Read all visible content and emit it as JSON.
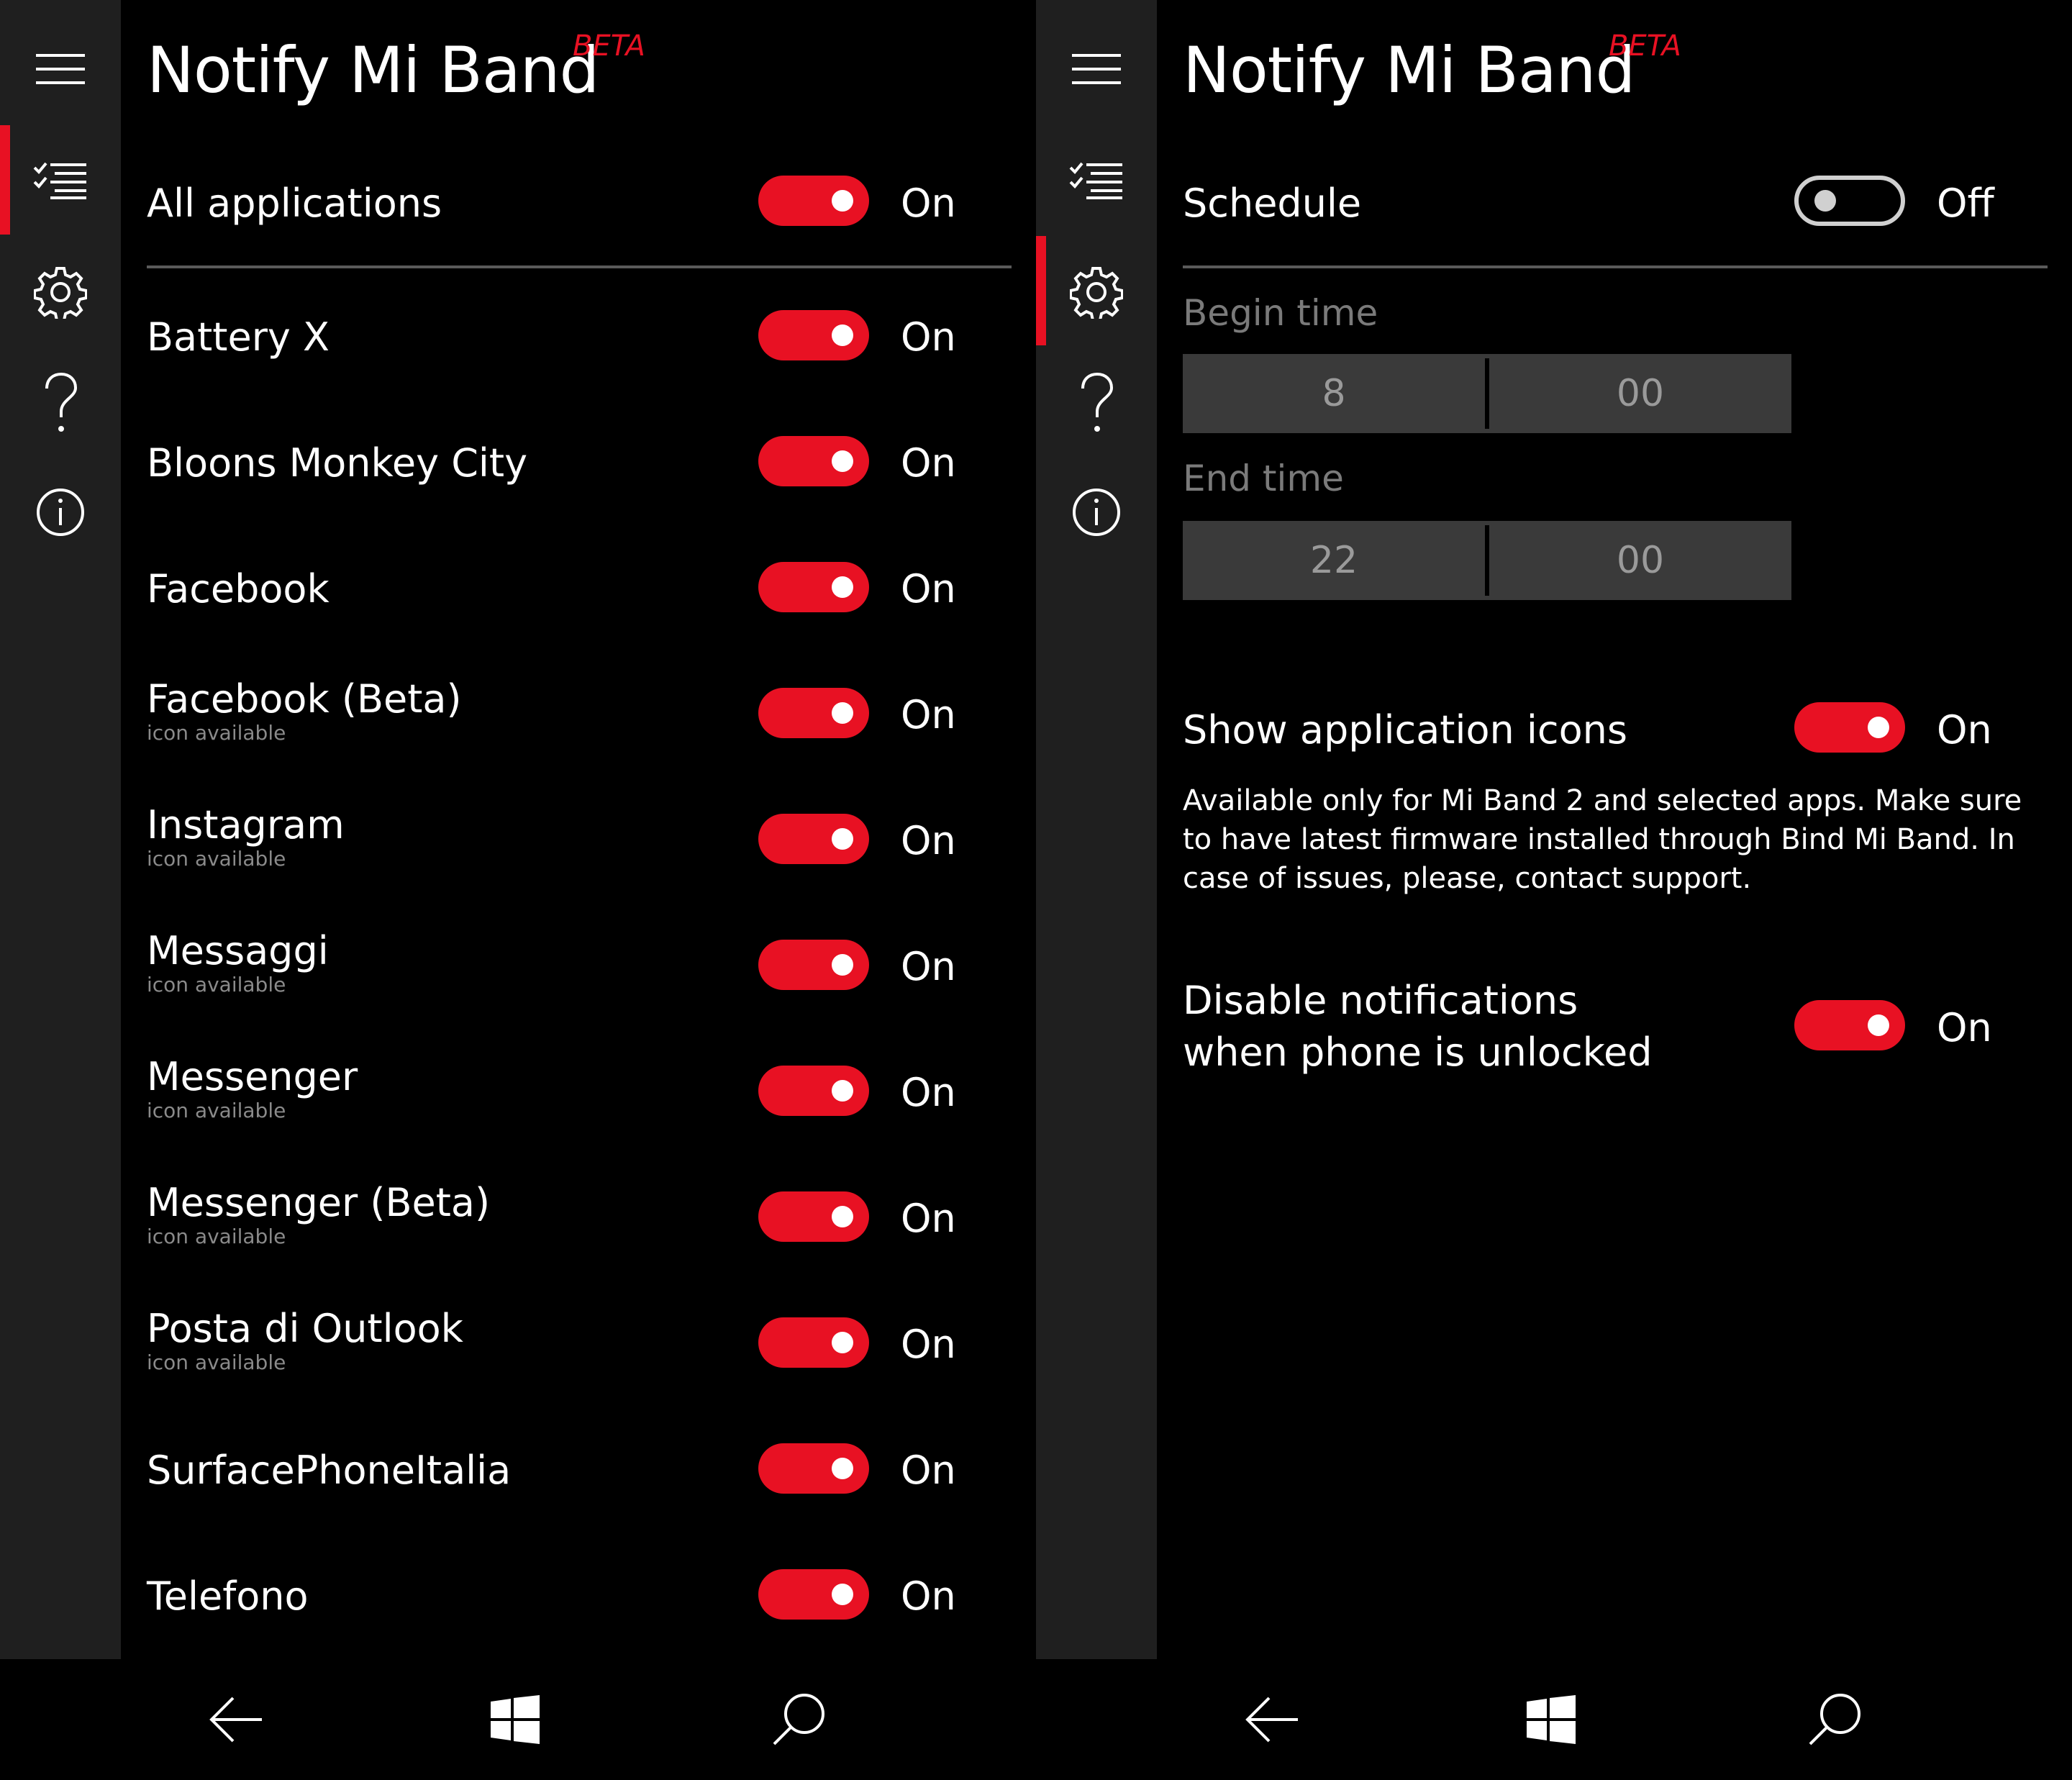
{
  "app": {
    "title": "Notify Mi Band",
    "badge": "BETA",
    "accent_color": "#e81123"
  },
  "rail": {
    "icons": [
      "hamburger-icon",
      "checklist-icon",
      "gear-icon",
      "question-icon",
      "info-icon"
    ]
  },
  "left_panel": {
    "all_apps": {
      "label": "All applications",
      "state": "On"
    },
    "apps": [
      {
        "name": "Battery X",
        "sub": "",
        "state": "On"
      },
      {
        "name": "Bloons Monkey City",
        "sub": "",
        "state": "On"
      },
      {
        "name": "Facebook",
        "sub": "",
        "state": "On"
      },
      {
        "name": "Facebook (Beta)",
        "sub": "icon available",
        "state": "On"
      },
      {
        "name": "Instagram",
        "sub": "icon available",
        "state": "On"
      },
      {
        "name": "Messaggi",
        "sub": "icon available",
        "state": "On"
      },
      {
        "name": "Messenger",
        "sub": "icon available",
        "state": "On"
      },
      {
        "name": "Messenger (Beta)",
        "sub": "icon available",
        "state": "On"
      },
      {
        "name": "Posta di Outlook",
        "sub": "icon available",
        "state": "On"
      },
      {
        "name": "SurfacePhoneItalia",
        "sub": "",
        "state": "On"
      },
      {
        "name": "Telefono",
        "sub": "",
        "state": "On"
      }
    ]
  },
  "right_panel": {
    "schedule": {
      "label": "Schedule",
      "state": "Off"
    },
    "begin_time": {
      "label": "Begin time",
      "hour": "8",
      "minute": "00"
    },
    "end_time": {
      "label": "End time",
      "hour": "22",
      "minute": "00"
    },
    "show_icons": {
      "label": "Show application icons",
      "state": "On",
      "description": "Available only for Mi Band 2 and selected apps. Make sure to have latest firmware installed through Bind Mi Band. In case of issues, please, contact support."
    },
    "disable_unlocked": {
      "label_line1": "Disable notifications",
      "label_line2": "when phone is unlocked",
      "state": "On"
    }
  },
  "navbar": {
    "icons": [
      "back-arrow-icon",
      "windows-logo-icon",
      "search-icon"
    ]
  }
}
